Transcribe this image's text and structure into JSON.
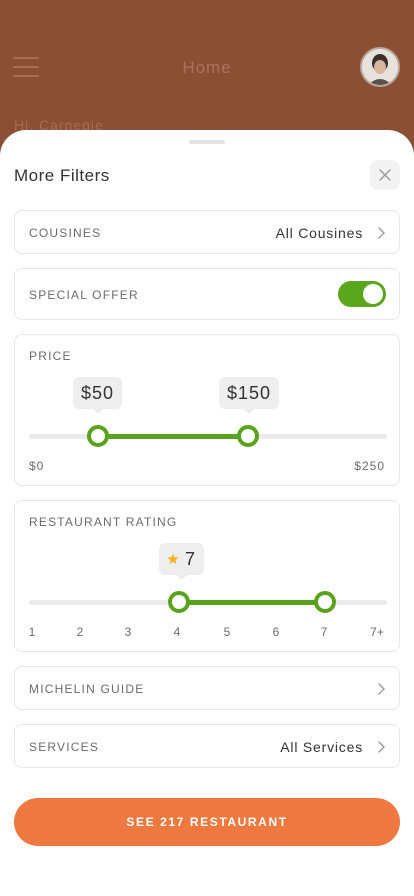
{
  "background": {
    "title": "Home",
    "greeting": "Hi, Carnegie"
  },
  "sheet": {
    "title": "More Filters"
  },
  "filters": {
    "cousines": {
      "label": "COUSINES",
      "value": "All Cousines"
    },
    "special_offer": {
      "label": "SPECIAL OFFER",
      "enabled": true
    },
    "price": {
      "label": "PRICE",
      "min_label": "$0",
      "max_label": "$250",
      "low_value": "$50",
      "high_value": "$150",
      "min": 0,
      "max": 250,
      "low": 50,
      "high": 150
    },
    "rating": {
      "label": "RESTAURANT RATING",
      "bubble_value": "7",
      "ticks": [
        "1",
        "2",
        "3",
        "4",
        "5",
        "6",
        "7",
        "7+"
      ],
      "low": 4,
      "high": 7
    },
    "michelin": {
      "label": "MICHELIN GUIDE"
    },
    "services": {
      "label": "SERVICES",
      "value": "All Services"
    }
  },
  "cta": {
    "label": "SEE 217 RESTAURANT"
  },
  "colors": {
    "accent_green": "#58a31b",
    "cta_orange": "#ed7940",
    "background_brown": "#8a4f35"
  },
  "icons": [
    "menu-icon",
    "avatar",
    "close-icon",
    "chevron-right-icon",
    "star-icon"
  ]
}
